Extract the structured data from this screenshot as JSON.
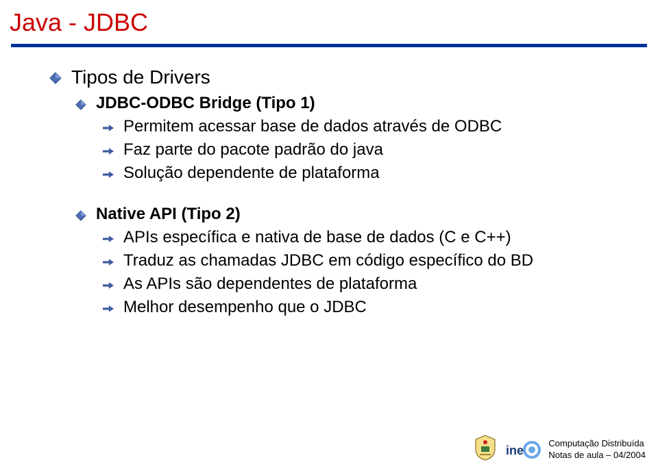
{
  "title": "Java - JDBC",
  "colors": {
    "title_red": "#cc0000",
    "rule_blue": "#003399",
    "bullet_blue": "#4a6db3",
    "arrow_blue": "#3a5aa0"
  },
  "bullets": {
    "section1": {
      "heading": "Tipos de Drivers",
      "item1": {
        "label": "JDBC-ODBC Bridge (Tipo 1)",
        "sub1": "Permitem acessar base de dados através de ODBC",
        "sub2": "Faz parte do pacote padrão do java",
        "sub3": "Solução dependente de plataforma"
      },
      "item2": {
        "label": "Native API (Tipo 2)",
        "sub1": "APIs específica e nativa de base de dados (C e C++)",
        "sub2": "Traduz as chamadas JDBC em código específico do BD",
        "sub3": "As APIs são dependentes de plataforma",
        "sub4": "Melhor desempenho que o JDBC"
      }
    }
  },
  "footer": {
    "line1": "Computação Distribuída",
    "line2": "Notas de aula   –   04/2004"
  },
  "logos": {
    "crest": "university-crest",
    "ine": "ine-logo"
  }
}
